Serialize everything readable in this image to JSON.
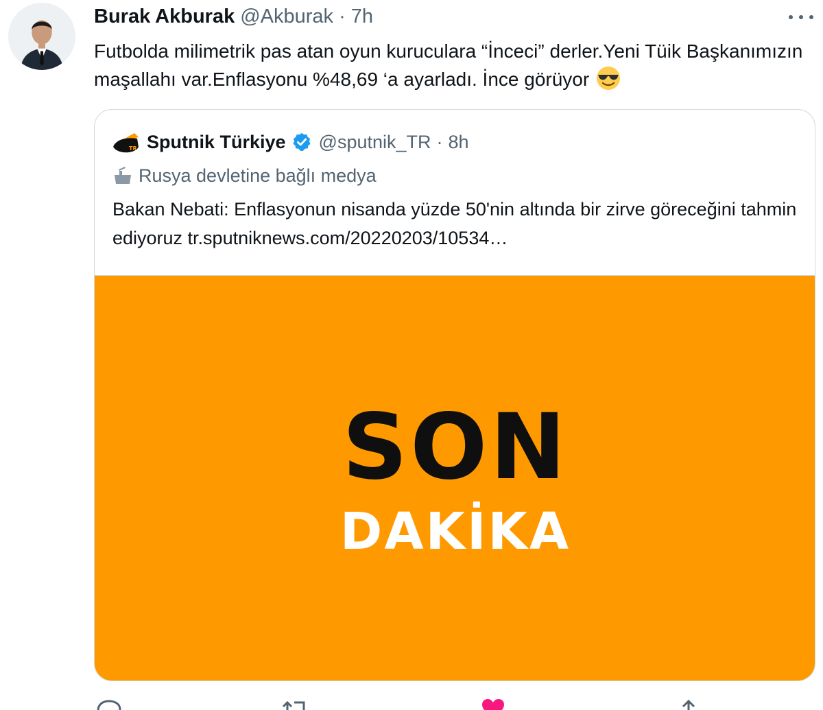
{
  "author": {
    "display_name": "Burak Akburak",
    "handle": "@Akburak",
    "separator": "·",
    "time": "7h",
    "avatar_icon": "profile-photo"
  },
  "tweet": {
    "text": "Futbolda milimetrik pas atan oyun kuruculara “İnceci” derler.Yeni Tüik Başkanımızın maşallahı var.Enflasyonu %48,69 ‘a ayarladı. İnce görüyor",
    "emoji_icon": "smiling-face-with-sunglasses"
  },
  "quote": {
    "display_name": "Sputnik Türkiye",
    "handle": "@sputnik_TR",
    "separator": "·",
    "time": "8h",
    "verified_color": "#1d9bf0",
    "label": "Rusya devletine bağlı medya",
    "text": "Bakan Nebati: Enflasyonun nisanda yüzde 50'nin altında bir zirve göreceğini tahmin ediyoruz tr.sputniknews.com/20220203/10534…",
    "media": {
      "line1": "SON",
      "line2": "DAKİKA",
      "background": "#ff9900"
    }
  },
  "actions": [
    "reply-icon",
    "retweet-icon",
    "like-icon",
    "share-icon"
  ],
  "colors": {
    "text": "#0f1419",
    "secondary": "#536471",
    "border": "#cfd9de",
    "like": "#f91880"
  }
}
